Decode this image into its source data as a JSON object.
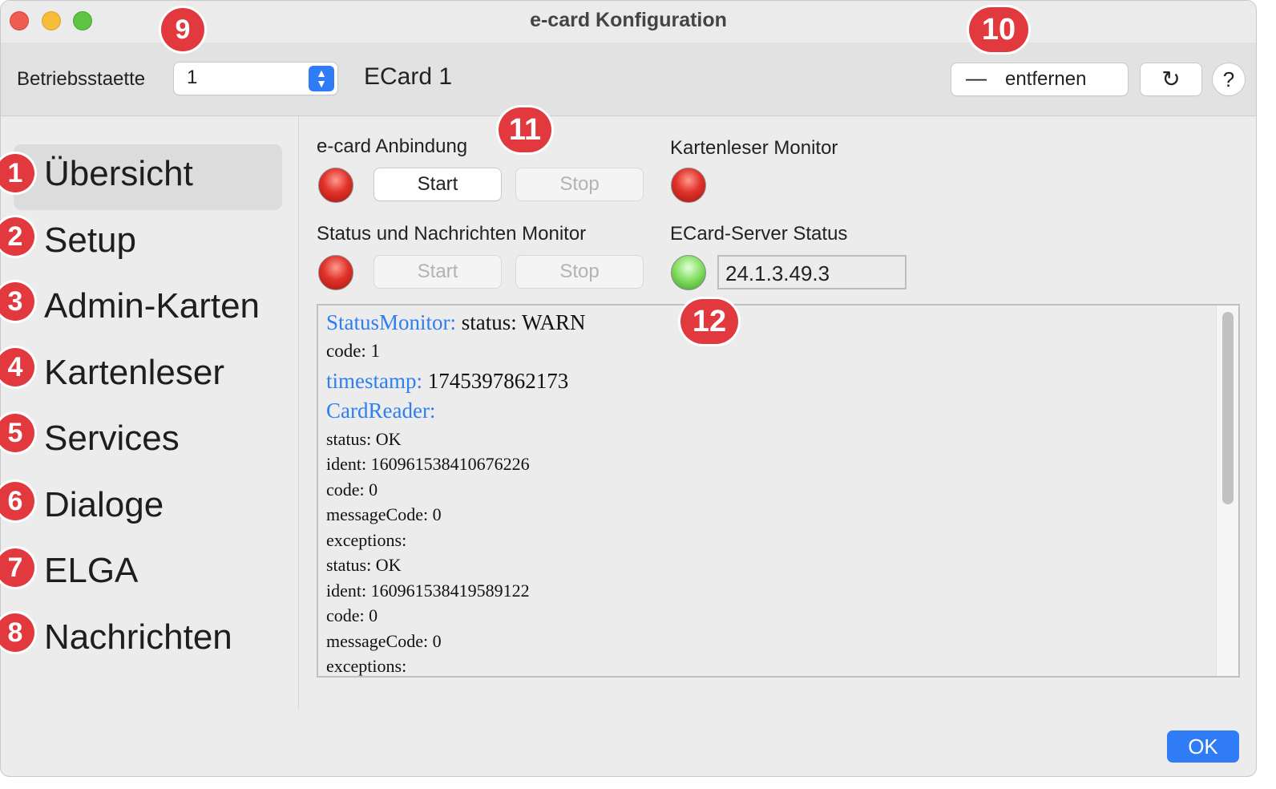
{
  "window": {
    "title": "e-card Konfiguration"
  },
  "toolbar": {
    "betriebsstaette_label": "Betriebsstaette",
    "betriebsstaette_value": "1",
    "ecard_name": "ECard 1",
    "remove_label": "entfernen",
    "remove_glyph": "—",
    "refresh_glyph": "↻",
    "help_glyph": "?"
  },
  "sidebar": {
    "items": [
      {
        "label": "Übersicht",
        "badge": "1",
        "active": true
      },
      {
        "label": "Setup",
        "badge": "2"
      },
      {
        "label": "Admin-Karten",
        "badge": "3"
      },
      {
        "label": "Kartenleser",
        "badge": "4"
      },
      {
        "label": "Services",
        "badge": "5"
      },
      {
        "label": "Dialoge",
        "badge": "6"
      },
      {
        "label": "ELGA",
        "badge": "7"
      },
      {
        "label": "Nachrichten",
        "badge": "8"
      }
    ]
  },
  "annotations": {
    "b9": "9",
    "b10": "10",
    "b11": "11",
    "b12": "12"
  },
  "main": {
    "ecard_anbindung": {
      "label": "e-card Anbindung",
      "start": "Start",
      "stop": "Stop",
      "led": "red"
    },
    "kartenleser_monitor": {
      "label": "Kartenleser Monitor",
      "led": "red"
    },
    "status_monitor": {
      "label": "Status und Nachrichten Monitor",
      "start": "Start",
      "stop": "Stop",
      "led": "red"
    },
    "server_status": {
      "label": "ECard-Server Status",
      "value": "24.1.3.49.3",
      "led": "green"
    },
    "log": {
      "lines": [
        {
          "key": "StatusMonitor:",
          "text": " status: WARN"
        },
        {
          "key": "",
          "text": "code: 1"
        },
        {
          "key": "timestamp:",
          "text": " 1745397862173"
        },
        {
          "key": "CardReader:",
          "text": ""
        },
        {
          "key": "",
          "text": "status: OK"
        },
        {
          "key": "",
          "text": "ident: 1609615384106762​26"
        },
        {
          "key": "",
          "text": "code: 0"
        },
        {
          "key": "",
          "text": "messageCode: 0"
        },
        {
          "key": "",
          "text": "exceptions:"
        },
        {
          "key": "",
          "text": "status: OK"
        },
        {
          "key": "",
          "text": "ident: 160961538419589122"
        },
        {
          "key": "",
          "text": "code: 0"
        },
        {
          "key": "",
          "text": "messageCode: 0"
        },
        {
          "key": "",
          "text": "exceptions:"
        }
      ]
    }
  },
  "footer": {
    "ok_label": "OK"
  },
  "colors": {
    "accent": "#2f7cf6",
    "badge": "#e1393e",
    "log_key": "#2e7ef2"
  }
}
